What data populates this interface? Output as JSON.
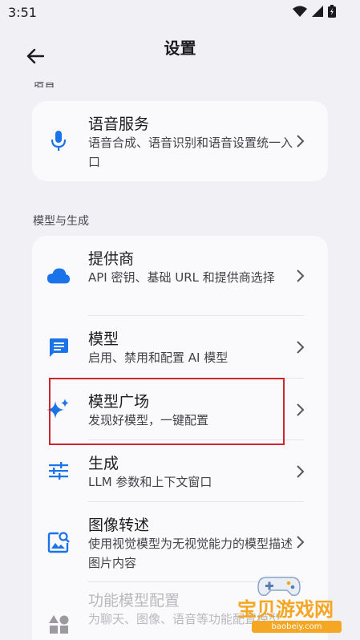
{
  "status_bar": {
    "time": "3:51"
  },
  "app_bar": {
    "title": "设置"
  },
  "sections": {
    "top_partial_label": "语音",
    "speech": {
      "items": [
        {
          "title": "语音服务",
          "subtitle": "语音合成、语音识别和语音设置统一入口",
          "icon": "microphone-icon"
        }
      ]
    },
    "model_gen": {
      "label": "模型与生成",
      "items": [
        {
          "title": "提供商",
          "subtitle": "API 密钥、基础 URL 和提供商选择",
          "icon": "cloud-icon"
        },
        {
          "title": "模型",
          "subtitle": "启用、禁用和配置 AI 模型",
          "icon": "chat-bubble-icon"
        },
        {
          "title": "模型广场",
          "subtitle": "发现好模型，一键配置",
          "icon": "sparkle-icon"
        },
        {
          "title": "生成",
          "subtitle": "LLM 参数和上下文窗口",
          "icon": "sliders-icon"
        },
        {
          "title": "图像转述",
          "subtitle": "使用视觉模型为无视觉能力的模型描述图片内容",
          "icon": "image-search-icon"
        },
        {
          "title": "功能模型配置",
          "subtitle": "为聊天、图像、语音等功能配置模型",
          "icon": "shapes-icon"
        }
      ]
    }
  },
  "watermark": {
    "text": "宝贝游戏网",
    "url": "baobeiy.com"
  },
  "colors": {
    "accent": "#1a73e8",
    "background": "#f1f0f5",
    "card": "#fafafc",
    "highlight": "#d0242c"
  }
}
